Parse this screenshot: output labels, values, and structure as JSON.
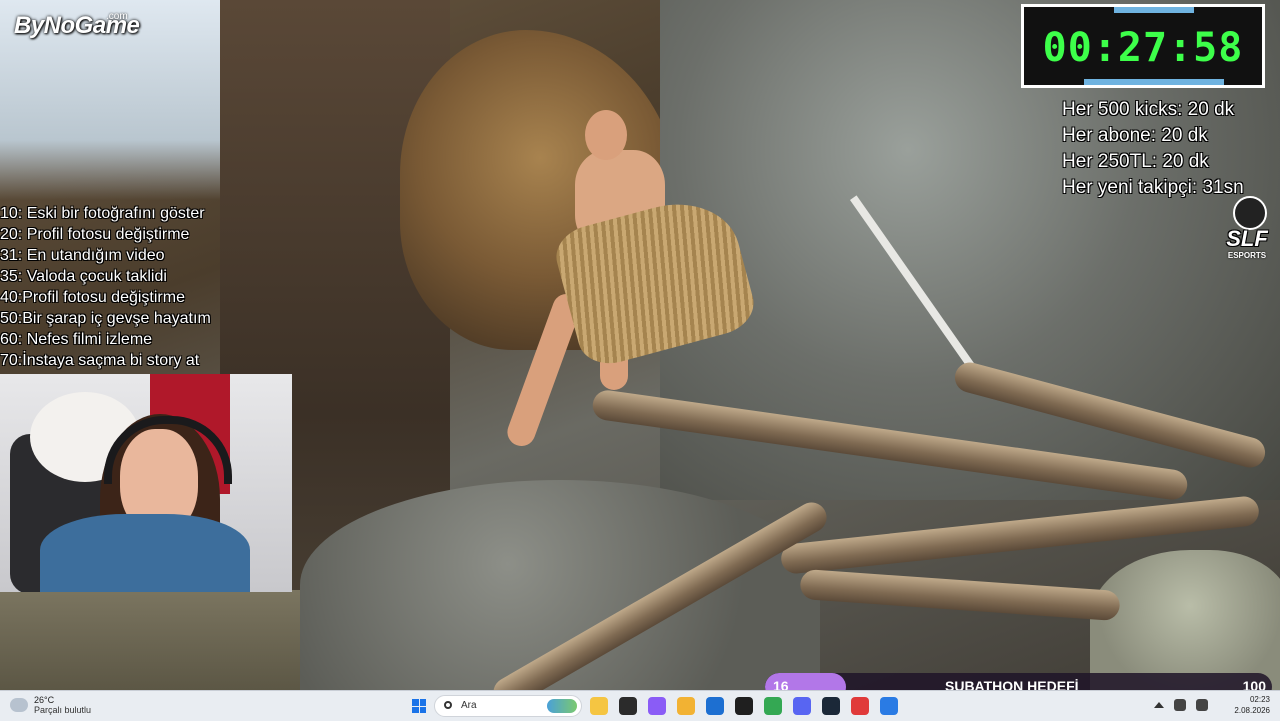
{
  "overlay": {
    "logo": "ByNoGame",
    "logo_suffix": ".com",
    "goals": [
      "10: Eski bir fotoğrafını göster",
      "20: Profil fotosu değiştirme",
      "31: En utandığım video",
      "35: Valoda çocuk taklidi",
      "40:Profil fotosu değiştirme",
      "50:Bir şarap iç gevşe hayatım",
      "60: Nefes filmi izleme",
      "70:İnstaya saçma bi story at"
    ],
    "timer": "00:27:58",
    "rates": [
      "Her 500 kicks: 20 dk",
      "Her abone: 20 dk",
      "Her 250TL: 20 dk",
      "Her yeni takipçi: 31sn"
    ],
    "team_logo": "SLF",
    "team_logo_sub": "ESPORTS",
    "subathon": {
      "current": "16",
      "label": "SUBATHON HEDEFİ",
      "target": "100",
      "progress": 0.16,
      "fill_color": "#b277e8"
    }
  },
  "taskbar": {
    "weather_temp": "26°C",
    "weather_desc": "Parçalı bulutlu",
    "search_placeholder": "Ara",
    "apps": [
      {
        "icon": "file-explorer-icon",
        "color": "#f5c542"
      },
      {
        "icon": "terminal-icon",
        "color": "#2b2b2b"
      },
      {
        "icon": "copilot-icon",
        "color": "#8a5cf6"
      },
      {
        "icon": "folder-icon",
        "color": "#f2b233"
      },
      {
        "icon": "store-icon",
        "color": "#1d6fd1"
      },
      {
        "icon": "obs-icon",
        "color": "#1f1f1f"
      },
      {
        "icon": "chrome-icon",
        "color": "#34a853"
      },
      {
        "icon": "discord-icon",
        "color": "#5865f2"
      },
      {
        "icon": "steam-icon",
        "color": "#1b2838"
      },
      {
        "icon": "app-red-icon",
        "color": "#e03a3a"
      },
      {
        "icon": "app-blue-icon",
        "color": "#2a7be4"
      }
    ],
    "time": "02:23",
    "date": "2.08.2026"
  }
}
